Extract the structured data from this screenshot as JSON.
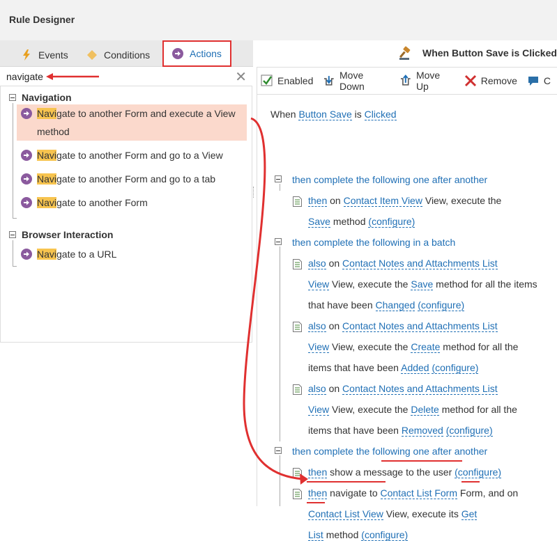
{
  "window": {
    "title": "Rule Designer"
  },
  "tabs": [
    {
      "label": "Events"
    },
    {
      "label": "Conditions"
    },
    {
      "label": "Actions"
    }
  ],
  "search": {
    "value": "navigate"
  },
  "tree": {
    "groups": [
      {
        "label": "Navigation",
        "items": [
          {
            "hl": "Navi",
            "rest1": "gate to another Form and execute a View",
            "rest2": "method"
          },
          {
            "hl": "Navi",
            "rest1": "gate to another Form and go to a View"
          },
          {
            "hl": "Navi",
            "rest1": "gate to another Form and go to a tab"
          },
          {
            "hl": "Navi",
            "rest1": "gate to another Form"
          }
        ]
      },
      {
        "label": "Browser Interaction",
        "items": [
          {
            "hl": "Navi",
            "rest1": "gate to a URL"
          }
        ]
      }
    ]
  },
  "rule_header": {
    "title": "When Button Save is Clicked"
  },
  "toolbar": {
    "enabled": "Enabled",
    "move_down": "Move Down",
    "move_up": "Move Up",
    "remove": "Remove",
    "comment": "C"
  },
  "rule": {
    "when": "When",
    "button_save": "Button Save",
    "is": "is",
    "clicked": "Clicked",
    "block1": "then complete the following one after another",
    "a1_then": "then",
    "a1_on": "on",
    "a1_view": "Contact Item View",
    "a1_text": "View, execute the",
    "a1_method": "Save",
    "a1_method_txt": "method",
    "configure": "(configure)",
    "block2": "then complete the following in a batch",
    "also": "also",
    "on": "on",
    "notes_list": "Contact Notes and Attachments List",
    "view": "View",
    "b1_text1": "View, execute the",
    "b1_method": "Save",
    "b1_text2": "method for all the items",
    "b1_text3": "that have been",
    "b1_state": "Changed",
    "b2_text1": "View, execute the",
    "b2_method": "Create",
    "b2_text2": "method for all the",
    "b2_text3": "items that have been",
    "b2_state": "Added",
    "b3_text1": "View, execute the",
    "b3_method": "Delete",
    "b3_text2": "method for all the",
    "b3_text3": "items that have been",
    "b3_state": "Removed",
    "block3": "then complete the following one after another",
    "c1_then": "then",
    "c1_text": "show a message to the user",
    "c2_then": "then",
    "c2_text1": "navigate to",
    "c2_form": "Contact List Form",
    "c2_text2": "Form, and on",
    "c2_view": "Contact List View",
    "c2_text3": "View, execute its",
    "c2_get": "Get",
    "c2_list": "List",
    "c2_method": "method"
  },
  "colors": {
    "accent": "#1f6fb5",
    "annotation": "#e03030",
    "highlight": "#f7c44f",
    "selection": "#fbd9cc"
  }
}
